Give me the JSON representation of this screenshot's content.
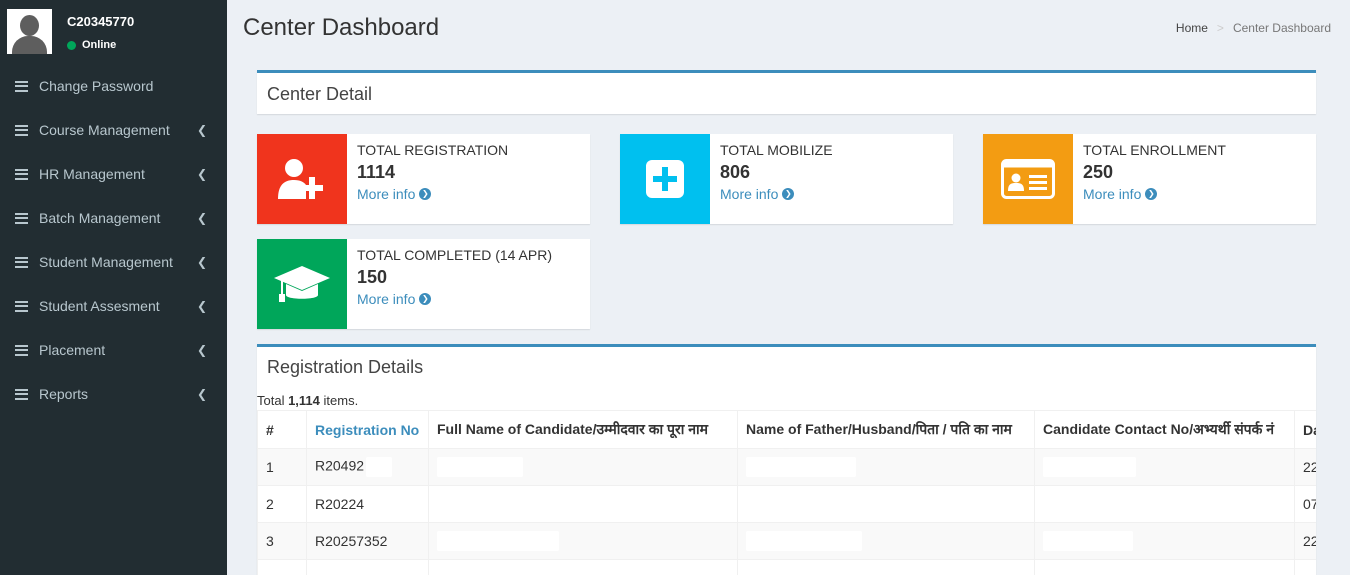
{
  "user": {
    "name": "C20345770",
    "status": "Online"
  },
  "sidebar": {
    "items": [
      {
        "label": "Change Password",
        "has_submenu": false
      },
      {
        "label": "Course Management",
        "has_submenu": true
      },
      {
        "label": "HR Management",
        "has_submenu": true
      },
      {
        "label": "Batch Management",
        "has_submenu": true
      },
      {
        "label": "Student Management",
        "has_submenu": true
      },
      {
        "label": "Student Assesment",
        "has_submenu": true
      },
      {
        "label": "Placement",
        "has_submenu": true
      },
      {
        "label": "Reports",
        "has_submenu": true
      }
    ]
  },
  "header": {
    "title": "Center Dashboard",
    "breadcrumb": {
      "home": "Home",
      "separator": ">",
      "current": "Center Dashboard"
    }
  },
  "center_detail": {
    "title": "Center Detail"
  },
  "stats": [
    {
      "label": "TOTAL REGISTRATION",
      "value": "1114",
      "link": "More info",
      "color": "#f0341d",
      "icon": "add-user-icon"
    },
    {
      "label": "TOTAL MOBILIZE",
      "value": "806",
      "link": "More info",
      "color": "#00c0ef",
      "icon": "plus-square-icon"
    },
    {
      "label": "TOTAL ENROLLMENT",
      "value": "250",
      "link": "More info",
      "color": "#f39c12",
      "icon": "id-card-icon"
    },
    {
      "label": "TOTAL COMPLETED (14 APR)",
      "value": "150",
      "link": "More info",
      "color": "#00a65a",
      "icon": "graduation-cap-icon"
    }
  ],
  "registration": {
    "title": "Registration Details",
    "summary_prefix": "Total ",
    "summary_count": "1,114",
    "summary_suffix": " items.",
    "columns": [
      "#",
      "Registration No",
      "Full Name of Candidate/उम्मीदवार का पूरा नाम",
      "Name of Father/Husband/पिता / पति का नाम",
      "Candidate Contact No/अभ्यर्थी संपर्क नं",
      "Da"
    ],
    "rows": [
      {
        "num": "1",
        "reg_no": "R20492",
        "date": "22"
      },
      {
        "num": "2",
        "reg_no": "R20224",
        "date": "07"
      },
      {
        "num": "3",
        "reg_no": "R20257352",
        "date": "22"
      }
    ]
  },
  "colors": {
    "sidebar_bg": "#222d32",
    "accent": "#3c8dbc",
    "online": "#00a65a"
  }
}
